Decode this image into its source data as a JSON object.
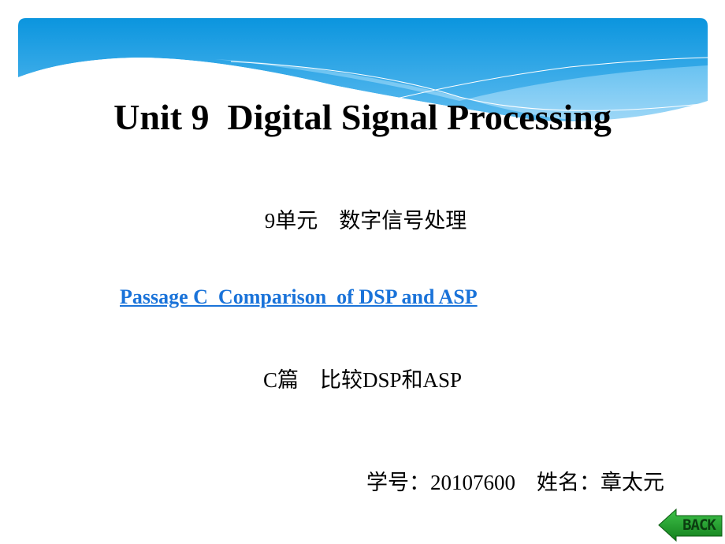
{
  "slide": {
    "title": "Unit 9  Digital Signal Processing",
    "subtitle_cn": "9单元    数字信号处理",
    "passage_link": "Passage C  Comparison  of DSP and ASP",
    "passage_cn": "C篇    比较DSP和ASP",
    "student_info": "学号：20107600    姓名：章太元",
    "back_button_label": "BACK"
  },
  "colors": {
    "banner_top": "#0b95de",
    "banner_bottom": "#5ebcf0",
    "link": "#1a73d9",
    "back_button": "#1f9a2a"
  }
}
